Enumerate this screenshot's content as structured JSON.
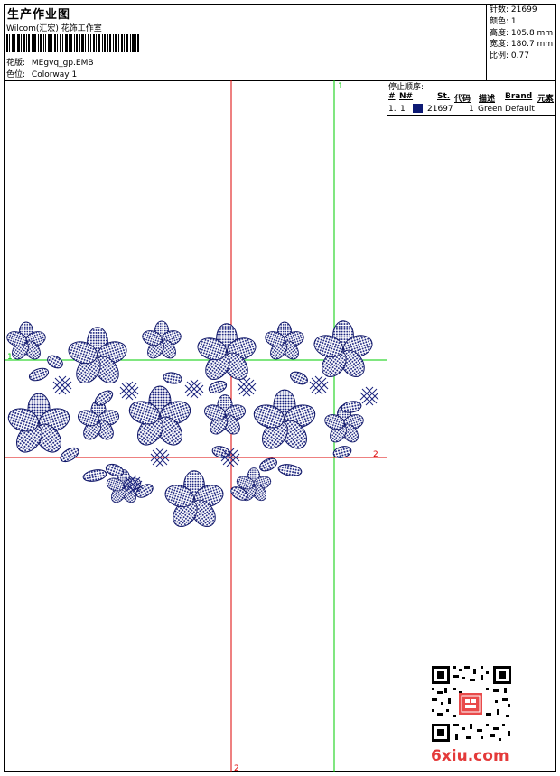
{
  "header": {
    "title": "生产作业图",
    "studio": "Wilcom(汇宏) 花饰工作室",
    "design_label": "花版:",
    "design_value": "MEgvq_gp.EMB",
    "color_label": "色位:",
    "color_value": "Colorway 1"
  },
  "stats": [
    {
      "label": "针数:",
      "value": "21699"
    },
    {
      "label": "颜色:",
      "value": "1"
    },
    {
      "label": "高度:",
      "value": "105.8 mm"
    },
    {
      "label": "宽度:",
      "value": "180.7 mm"
    },
    {
      "label": "比例:",
      "value": "0.77"
    }
  ],
  "stop_sequence": {
    "title": "停止顺序:",
    "columns": [
      "#",
      "N#",
      "St.",
      "代码",
      "描述",
      "Brand",
      "元素"
    ],
    "rows": [
      {
        "index": "1.",
        "needle": "1",
        "stitches": "21697",
        "code": "1",
        "description": "Green",
        "brand": "Default",
        "swatch_color": "#0d1a74"
      }
    ]
  },
  "guides": {
    "v_green_label": "1",
    "h_green_label": "1",
    "h_red_label": "2",
    "v_red_label": "2",
    "green_color": "#00cc00",
    "red_color": "#dd0000"
  },
  "design_colors": {
    "fill": "#1a237e",
    "outline": "#0d1466"
  },
  "watermark": {
    "text": "6xiu.com",
    "color": "#e43a3a"
  }
}
